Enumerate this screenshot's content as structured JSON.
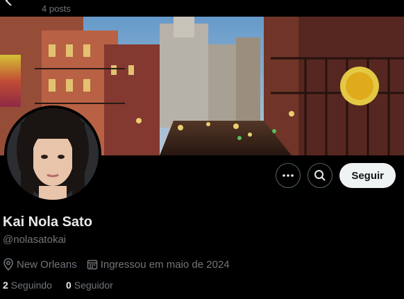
{
  "header": {
    "post_count": "4 posts"
  },
  "profile": {
    "name": "Kai Nola Sato",
    "handle": "@nolasatokai",
    "location": "New Orleans",
    "joined": "Ingressou em maio de 2024",
    "following_count": "2",
    "following_label": "Seguindo",
    "followers_count": "0",
    "followers_label": "Seguidor"
  },
  "actions": {
    "follow_label": "Seguir"
  },
  "icons": {
    "back": "back-arrow-icon",
    "more": "more-options-icon",
    "search": "search-icon",
    "location": "location-pin-icon",
    "calendar": "calendar-icon"
  },
  "colors": {
    "background": "#000000",
    "secondary_text": "#71767b",
    "primary_text": "#e7e9ea",
    "follow_button": "#eff3f4"
  }
}
